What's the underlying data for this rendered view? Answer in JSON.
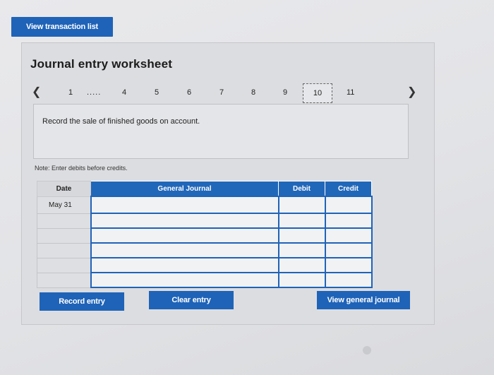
{
  "toolbar": {
    "view_transaction_list": "View transaction list"
  },
  "worksheet": {
    "title": "Journal entry worksheet",
    "pager": {
      "items": [
        "1",
        ".....",
        "4",
        "5",
        "6",
        "7",
        "8",
        "9",
        "10",
        "11"
      ],
      "current": "10"
    },
    "instruction": "Record the sale of finished goods on account.",
    "note": "Note: Enter debits before credits.",
    "table": {
      "headers": {
        "date": "Date",
        "journal": "General Journal",
        "debit": "Debit",
        "credit": "Credit"
      },
      "rows": [
        {
          "date": "May 31"
        },
        {
          "date": ""
        },
        {
          "date": ""
        },
        {
          "date": ""
        },
        {
          "date": ""
        },
        {
          "date": ""
        }
      ]
    },
    "buttons": {
      "record": "Record entry",
      "clear": "Clear entry",
      "view_journal": "View general journal"
    }
  },
  "colors": {
    "accent": "#1f63b8"
  }
}
